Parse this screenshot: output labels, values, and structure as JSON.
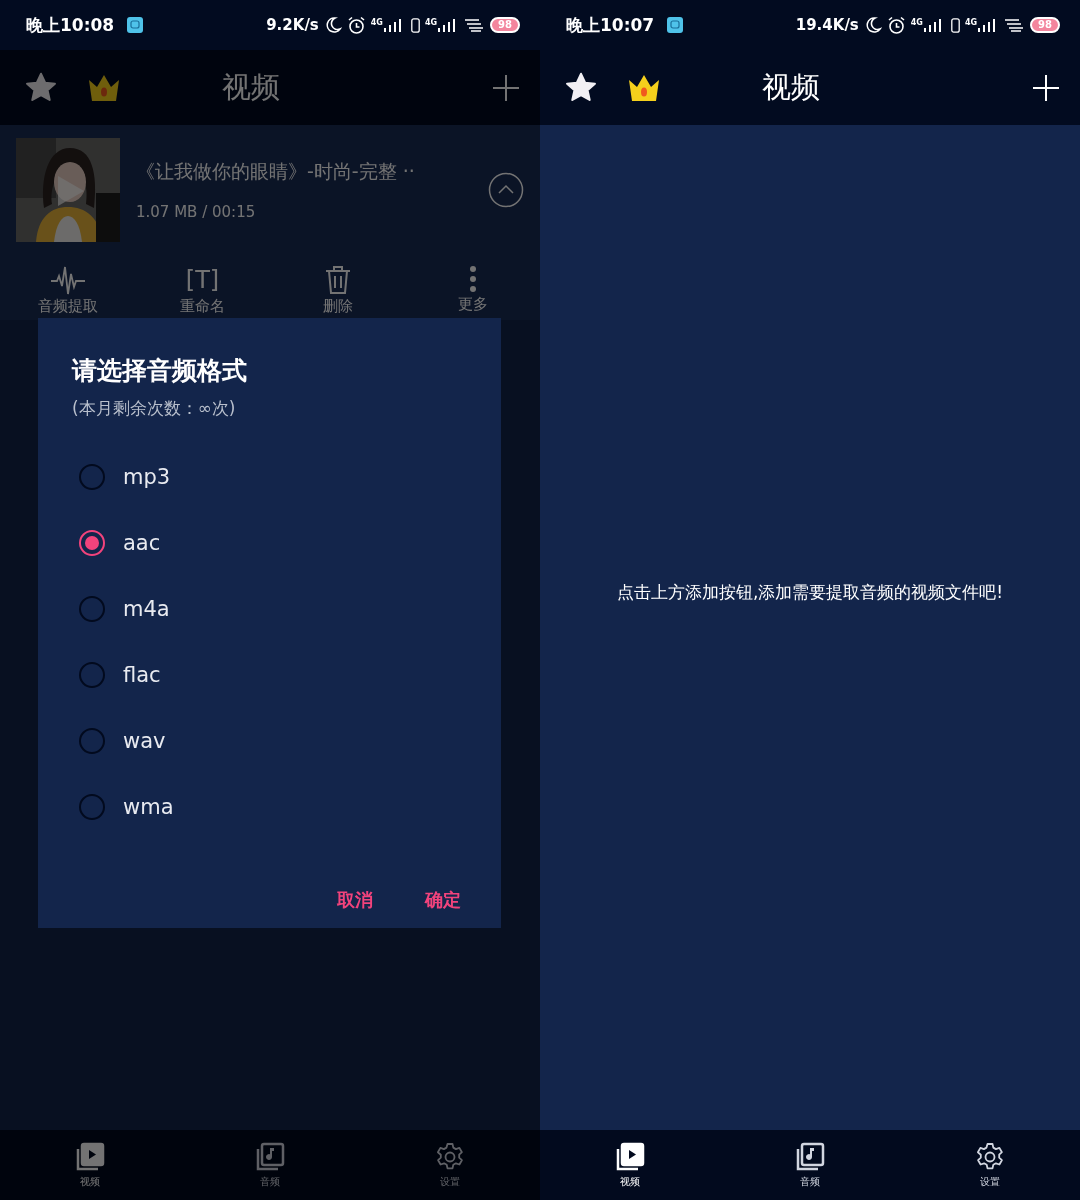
{
  "screens": [
    {
      "status_bar": {
        "time": "晚上10:08",
        "speed": "9.2K/s",
        "networks": [
          "4G",
          "4G"
        ],
        "battery": "98"
      },
      "header": {
        "title": "视频"
      },
      "dimmed": true,
      "video_item": {
        "title": "《让我做你的眼睛》-时尚-完整 ··",
        "meta": "1.07 MB / 00:15",
        "expanded": true
      },
      "actions": [
        {
          "kind": "extract",
          "label": "音频提取"
        },
        {
          "kind": "rename",
          "label": "重命名",
          "glyph": "[T]"
        },
        {
          "kind": "delete",
          "label": "删除"
        },
        {
          "kind": "more",
          "label": "更多"
        }
      ],
      "dialog": {
        "title": "请选择音频格式",
        "subtitle": "(本月剩余次数：∞次)",
        "options": [
          {
            "label": "mp3",
            "selected": false
          },
          {
            "label": "aac",
            "selected": true
          },
          {
            "label": "m4a",
            "selected": false
          },
          {
            "label": "flac",
            "selected": false
          },
          {
            "label": "wav",
            "selected": false
          },
          {
            "label": "wma",
            "selected": false
          }
        ],
        "buttons": [
          "取消",
          "确定"
        ]
      },
      "nav": [
        {
          "kind": "video",
          "label": "视频",
          "selected": true
        },
        {
          "kind": "audio",
          "label": "音频",
          "selected": false
        },
        {
          "kind": "settings",
          "label": "设置",
          "selected": false
        }
      ]
    },
    {
      "status_bar": {
        "time": "晚上10:07",
        "speed": "19.4K/s",
        "networks": [
          "4G",
          "4G"
        ],
        "battery": "98"
      },
      "header": {
        "title": "视频"
      },
      "empty_message": "点击上方添加按钮,添加需要提取音频的视频文件吧!",
      "nav": [
        {
          "kind": "video",
          "label": "视频",
          "selected": true
        },
        {
          "kind": "audio",
          "label": "音频",
          "selected": false
        },
        {
          "kind": "settings",
          "label": "设置",
          "selected": false
        }
      ]
    }
  ]
}
